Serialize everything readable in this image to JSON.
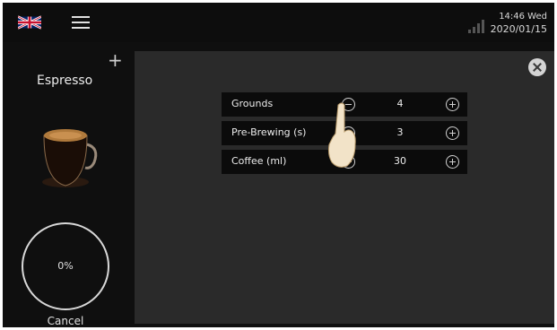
{
  "header": {
    "time_day": "14:46 Wed",
    "date": "2020/01/15",
    "flag_icon": "uk-flag-icon",
    "menu_icon": "hamburger-menu-icon",
    "signal_icon": "signal-strength-icon"
  },
  "sidebar": {
    "add_icon": "plus-icon",
    "title": "Espresso",
    "progress": "0%",
    "progress_value": 0,
    "cancel_label": "Cancel"
  },
  "settings": {
    "rows": [
      {
        "label": "Grounds",
        "value": "4"
      },
      {
        "label": "Pre-Brewing (s)",
        "value": "3"
      },
      {
        "label": "Coffee (ml)",
        "value": "30"
      }
    ]
  }
}
